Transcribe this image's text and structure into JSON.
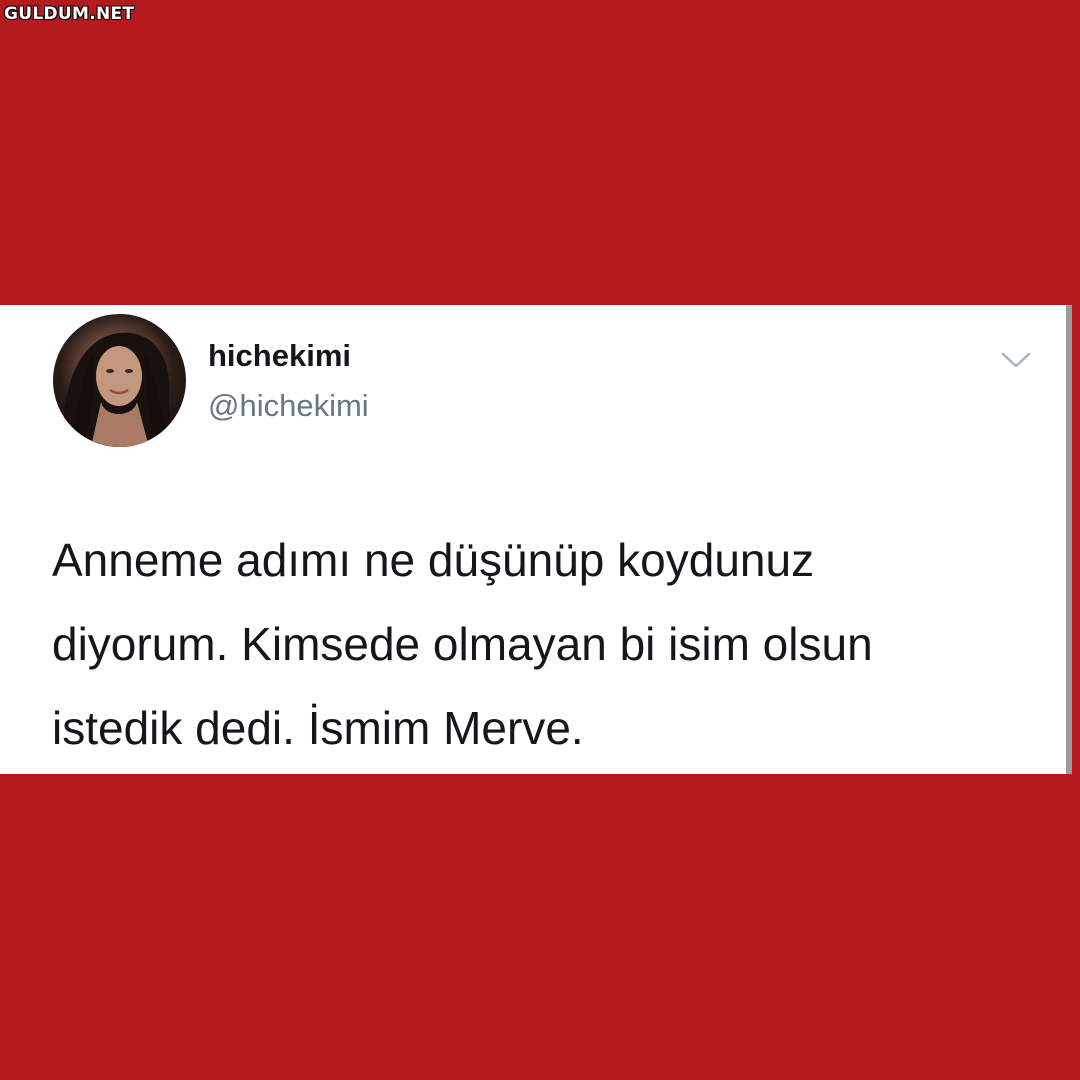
{
  "watermark": {
    "text": "GULDUM.NET"
  },
  "tweet": {
    "author": {
      "display_name": "hichekimi",
      "handle": "@hichekimi",
      "avatar_icon": "profile-photo"
    },
    "text_lines": [
      "Anneme adımı ne düşünüp koydunuz",
      "diyorum. Kimsede olmayan bi isim olsun",
      "istedik dedi. İsmim Merve."
    ],
    "menu_icon": "chevron-down-icon"
  },
  "colors": {
    "background": "#b31b1e",
    "card": "#ffffff",
    "primary_text": "#14171a",
    "secondary_text": "#657786",
    "chevron": "#aab8c2"
  }
}
